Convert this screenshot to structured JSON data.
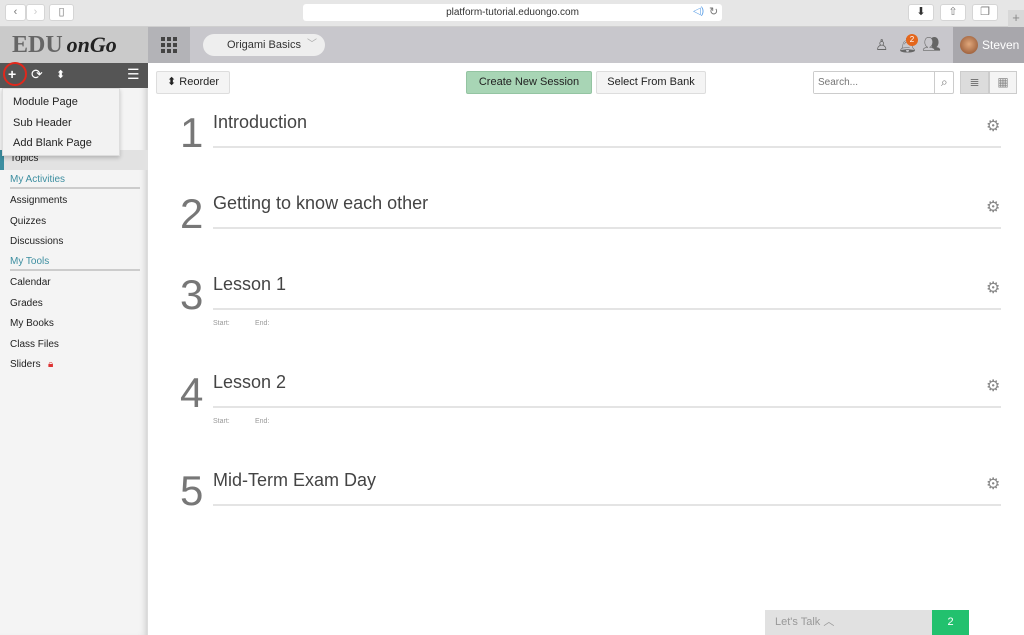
{
  "browser": {
    "url": "platform-tutorial.eduongo.com",
    "back_icon": "chevron-left",
    "forward_icon": "chevron-right"
  },
  "header": {
    "logo_edu": "EDU",
    "logo_ongo": "onGo",
    "course": "Origami Basics",
    "notifications": "2",
    "user": "Steven"
  },
  "sidebar": {
    "menu": [
      "Module Page",
      "Sub Header",
      "Add Blank Page"
    ],
    "topics": "Topics",
    "sections": [
      {
        "title": "My Activities",
        "items": [
          "Assignments",
          "Quizzes",
          "Discussions"
        ]
      },
      {
        "title": "My Tools",
        "items": [
          "Calendar",
          "Grades",
          "My Books",
          "Class Files",
          "Sliders"
        ]
      }
    ]
  },
  "toolbar": {
    "reorder": "Reorder",
    "create": "Create New Session",
    "bank": "Select From Bank",
    "search_placeholder": "Search..."
  },
  "sessions": [
    {
      "num": "1",
      "title": "Introduction"
    },
    {
      "num": "2",
      "title": "Getting to know each other"
    },
    {
      "num": "3",
      "title": "Lesson 1",
      "start": "Start:",
      "end": "End:"
    },
    {
      "num": "4",
      "title": "Lesson 2",
      "start": "Start:",
      "end": "End:"
    },
    {
      "num": "5",
      "title": "Mid-Term Exam Day"
    }
  ],
  "chat": {
    "label": "Let's Talk",
    "count": "2"
  },
  "colors": {
    "accent": "#3c8ea0",
    "create_button": "#a8d5b5",
    "chat": "#22c16e",
    "badge": "#e4661c"
  }
}
